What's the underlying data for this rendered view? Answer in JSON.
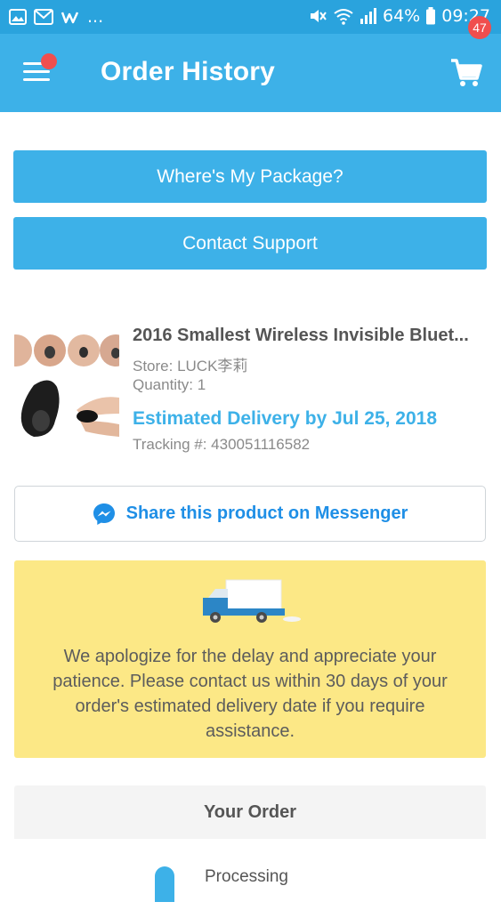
{
  "status_bar": {
    "left_icons": [
      "gallery-icon",
      "gmail-icon",
      "wish-icon"
    ],
    "more": "...",
    "battery": "64%",
    "time": "09:27"
  },
  "appbar": {
    "title": "Order History",
    "cart_count": "47"
  },
  "buttons": {
    "package": "Where's My Package?",
    "support": "Contact Support"
  },
  "product": {
    "title": "2016 Smallest Wireless Invisible Bluet...",
    "store": "Store: LUCK李莉",
    "quantity": "Quantity: 1",
    "delivery": "Estimated Delivery by Jul 25, 2018",
    "tracking": "Tracking #: 430051116582"
  },
  "share": {
    "label": "Share this product on Messenger"
  },
  "notice": {
    "text": "We apologize for the delay and appreciate your patience. Please contact us within 30 days of your order's estimated delivery date if you require assistance."
  },
  "order": {
    "header": "Your Order",
    "step": "Processing"
  },
  "colors": {
    "status_bar": "#2aa3dd",
    "app_bar": "#3db1e8",
    "notice_bg": "#fce886",
    "messenger_blue": "#1f8fe6",
    "badge_red": "#f04e4e"
  }
}
